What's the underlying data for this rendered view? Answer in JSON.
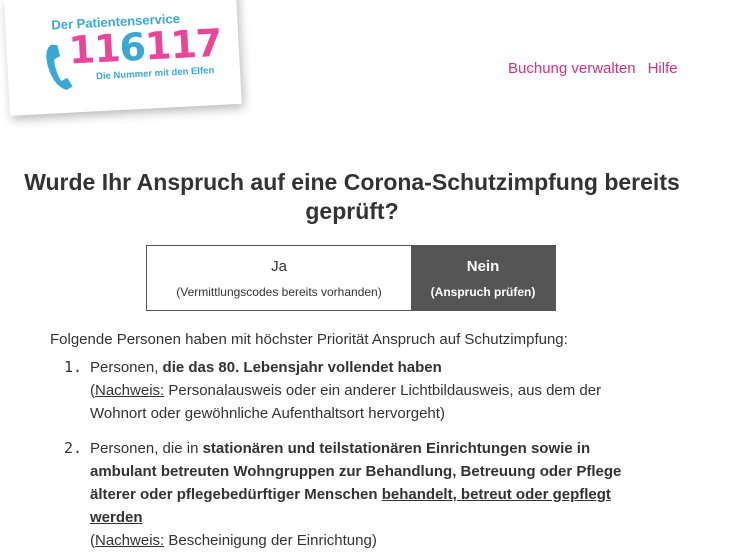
{
  "logo": {
    "tagline": "Der Patientenservice",
    "number_a": "11",
    "number_b": "6",
    "number_c": "117",
    "subline": "Die Nummer mit den Elfen"
  },
  "nav": {
    "manage_booking": "Buchung verwalten",
    "help": "Hilfe"
  },
  "question": "Wurde Ihr Anspruch auf eine Corona-Schutzimpfung bereits geprüft?",
  "toggle": {
    "options": [
      {
        "label": "Ja",
        "sublabel": "(Vermittlungscodes bereits vorhanden)",
        "selected": false
      },
      {
        "label": "Nein",
        "sublabel": "(Anspruch prüfen)",
        "selected": true
      }
    ]
  },
  "intro": "Folgende Personen haben mit höchster Priorität Anspruch auf Schutzimpfung:",
  "items": [
    {
      "number": "1.",
      "text_plain": "Personen, ",
      "text_bold": "die das 80. Lebensjahr vollendet haben",
      "proof_open": "(",
      "proof_label": "Nachweis:",
      "proof_text": " Personalausweis oder ein anderer Lichtbildausweis, aus dem der Wohnort oder gewöhnliche Aufenthaltsort hervorgeht)"
    },
    {
      "number": "2.",
      "text_plain": "Personen, die in ",
      "text_bold": "stationären und teilstationären Einrichtungen sowie in ambulant betreuten Wohngruppen zur Behandlung, Betreuung oder Pflege älterer oder pflegebedürftiger Menschen ",
      "text_bold_underlined": "behandelt, betreut oder gepflegt werden",
      "proof_open": "(",
      "proof_label": "Nachweis:",
      "proof_text": " Bescheinigung der Einrichtung)"
    }
  ],
  "colors": {
    "brand_pink": "#e9469b",
    "brand_blue": "#3aa8d6",
    "nav_link": "#d8307e",
    "selected_bg": "#555555"
  }
}
